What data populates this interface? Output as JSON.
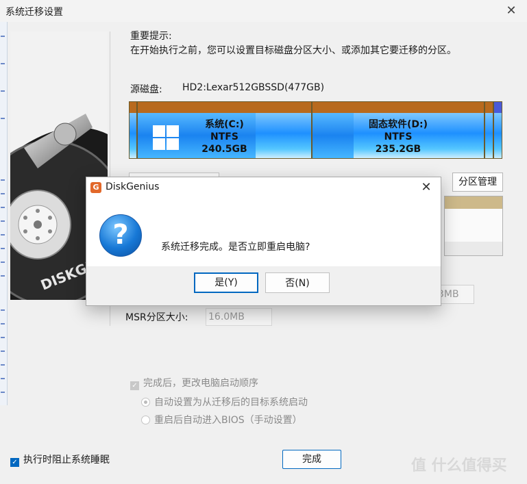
{
  "window": {
    "title": "系统迁移设置"
  },
  "hint": {
    "title": "重要提示:",
    "text": "在开始执行之前，您可以设置目标磁盘分区大小、或添加其它要迁移的分区。"
  },
  "source_disk": {
    "label": "源磁盘:",
    "value": "HD2:Lexar512GBSSD(477GB)"
  },
  "partitions": [
    {
      "name": "系统(C:)",
      "fs": "NTFS",
      "size": "240.5GB"
    },
    {
      "name": "固态软件(D:)",
      "fs": "NTFS",
      "size": "235.2GB"
    }
  ],
  "partition_mgmt_label": "分区管理",
  "right_input_value": "3MB",
  "msr": {
    "label": "MSR分区大小:",
    "value": "16.0MB"
  },
  "boot_order": {
    "checkbox_label": "完成后，更改电脑启动顺序",
    "options": [
      "自动设置为从迁移后的目标系统启动",
      "重启后自动进入BIOS（手动设置）"
    ]
  },
  "sleep_checkbox_label": "执行时阻止系统睡眠",
  "done_label": "完成",
  "watermark": "值 什么值得买",
  "dialog": {
    "title": "DiskGenius",
    "message": "系统迁移完成。是否立即重启电脑?",
    "yes_label": "是(Y)",
    "no_label": "否(N)"
  },
  "colors": {
    "accent": "#0067c0",
    "partition_cap": "#b86a1e",
    "partition_fill": "#1e90ff"
  }
}
